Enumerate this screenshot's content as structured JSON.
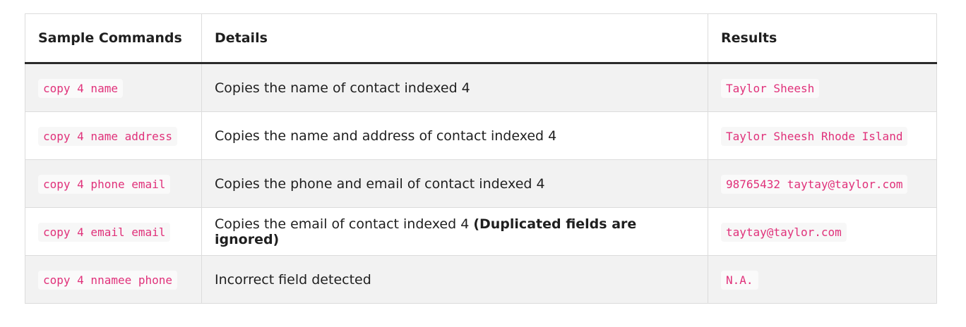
{
  "table": {
    "headers": [
      "Sample Commands",
      "Details",
      "Results"
    ],
    "rows": [
      {
        "command": "copy 4 name",
        "details": "Copies the name of contact indexed 4",
        "details_bold": "",
        "result": "Taylor Sheesh"
      },
      {
        "command": "copy 4 name address",
        "details": "Copies the name and address of contact indexed 4",
        "details_bold": "",
        "result": "Taylor Sheesh Rhode Island"
      },
      {
        "command": "copy 4 phone email",
        "details": "Copies the phone and email of contact indexed 4",
        "details_bold": "",
        "result": "98765432 taytay@taylor.com"
      },
      {
        "command": "copy 4 email email",
        "details": "Copies the email of contact indexed 4 ",
        "details_bold": "(Duplicated fields are ignored)",
        "result": "taytay@taylor.com"
      },
      {
        "command": "copy 4 nnamee phone",
        "details": "Incorrect field detected",
        "details_bold": "",
        "result": "N.A."
      }
    ]
  },
  "colors": {
    "code_text": "#e0317a",
    "row_alt_bg": "#f2f2f2",
    "header_rule": "#2a2a2a"
  }
}
